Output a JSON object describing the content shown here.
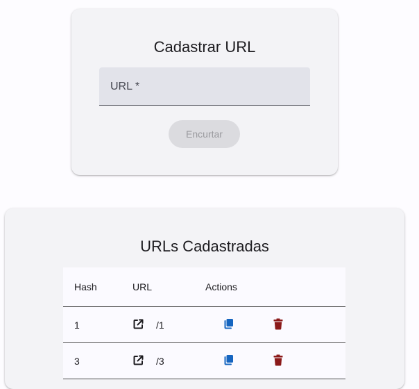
{
  "register_card": {
    "title": "Cadastrar URL",
    "url_field": {
      "label": "URL *",
      "value": ""
    },
    "shorten_button": "Encurtar"
  },
  "list_card": {
    "title": "URLs Cadastradas",
    "columns": {
      "hash": "Hash",
      "url": "URL",
      "actions": "Actions"
    },
    "rows": [
      {
        "hash": "1",
        "url": "/1"
      },
      {
        "hash": "3",
        "url": "/3"
      }
    ]
  },
  "icons": {
    "open_link": "external-link-icon",
    "copy": "copy-icon",
    "delete": "trash-icon"
  },
  "colors": {
    "copy_icon": "#1565c0",
    "delete_icon": "#8b1a1a",
    "disabled_button_bg": "#dbdbdf",
    "disabled_button_text": "#9a9a9e"
  }
}
